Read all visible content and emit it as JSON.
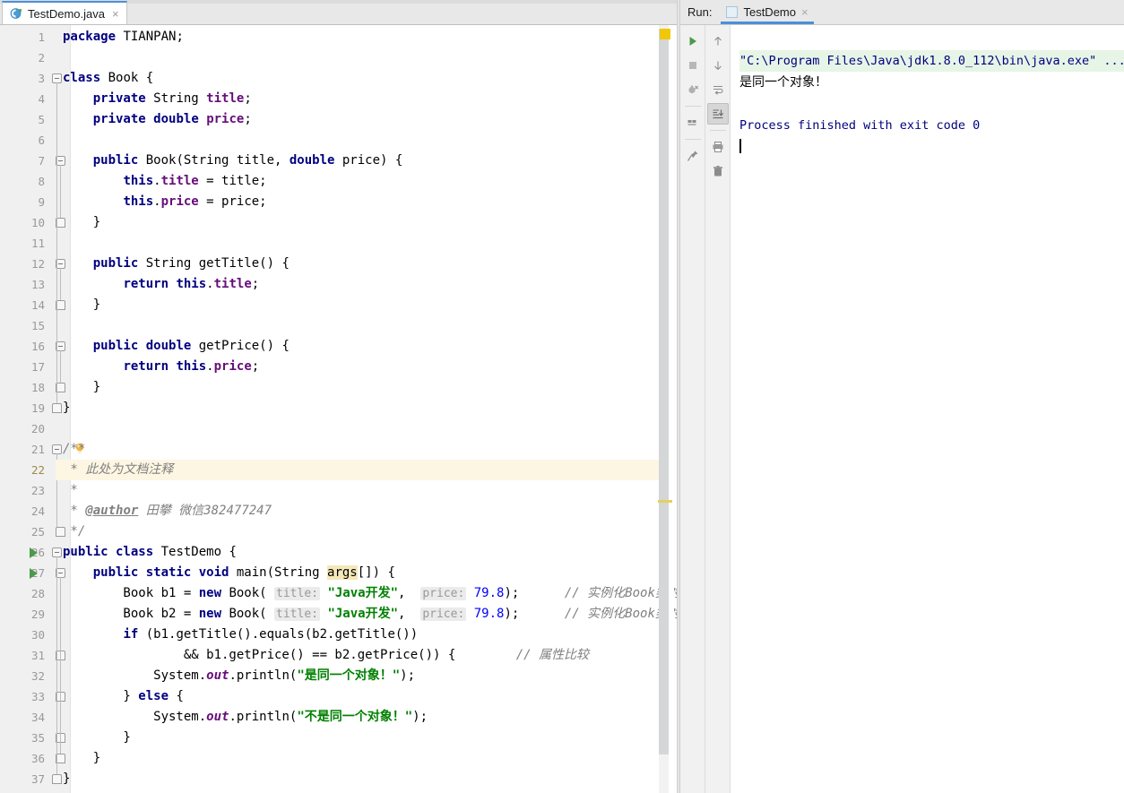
{
  "editor": {
    "tab": {
      "label": "TestDemo.java",
      "icon": "java-class-icon",
      "close": "×"
    },
    "lines": [
      {
        "n": 1,
        "tokens": [
          {
            "t": "kw",
            "s": "package"
          },
          {
            "t": "p",
            "s": " TIANPAN;"
          }
        ],
        "indent": 0
      },
      {
        "n": 2,
        "tokens": [],
        "indent": 0
      },
      {
        "n": 3,
        "tokens": [
          {
            "t": "kw",
            "s": "class"
          },
          {
            "t": "p",
            "s": " Book {"
          }
        ],
        "indent": 0
      },
      {
        "n": 4,
        "tokens": [
          {
            "t": "p",
            "s": "    "
          },
          {
            "t": "kw",
            "s": "private"
          },
          {
            "t": "p",
            "s": " String "
          },
          {
            "t": "fld",
            "s": "title"
          },
          {
            "t": "p",
            "s": ";"
          }
        ],
        "indent": 1
      },
      {
        "n": 5,
        "tokens": [
          {
            "t": "p",
            "s": "    "
          },
          {
            "t": "kw",
            "s": "private"
          },
          {
            "t": "p",
            "s": " "
          },
          {
            "t": "kw",
            "s": "double"
          },
          {
            "t": "p",
            "s": " "
          },
          {
            "t": "fld",
            "s": "price"
          },
          {
            "t": "p",
            "s": ";"
          }
        ],
        "indent": 1
      },
      {
        "n": 6,
        "tokens": [],
        "indent": 0
      },
      {
        "n": 7,
        "tokens": [
          {
            "t": "p",
            "s": "    "
          },
          {
            "t": "kw",
            "s": "public"
          },
          {
            "t": "p",
            "s": " Book(String title, "
          },
          {
            "t": "kw",
            "s": "double"
          },
          {
            "t": "p",
            "s": " price) {"
          }
        ],
        "indent": 1
      },
      {
        "n": 8,
        "tokens": [
          {
            "t": "p",
            "s": "        "
          },
          {
            "t": "kw",
            "s": "this"
          },
          {
            "t": "p",
            "s": "."
          },
          {
            "t": "fld",
            "s": "title"
          },
          {
            "t": "p",
            "s": " = title;"
          }
        ],
        "indent": 2
      },
      {
        "n": 9,
        "tokens": [
          {
            "t": "p",
            "s": "        "
          },
          {
            "t": "kw",
            "s": "this"
          },
          {
            "t": "p",
            "s": "."
          },
          {
            "t": "fld",
            "s": "price"
          },
          {
            "t": "p",
            "s": " = price;"
          }
        ],
        "indent": 2
      },
      {
        "n": 10,
        "tokens": [
          {
            "t": "p",
            "s": "    }"
          }
        ],
        "indent": 1
      },
      {
        "n": 11,
        "tokens": [],
        "indent": 0
      },
      {
        "n": 12,
        "tokens": [
          {
            "t": "p",
            "s": "    "
          },
          {
            "t": "kw",
            "s": "public"
          },
          {
            "t": "p",
            "s": " String getTitle() {"
          }
        ],
        "indent": 1
      },
      {
        "n": 13,
        "tokens": [
          {
            "t": "p",
            "s": "        "
          },
          {
            "t": "kw",
            "s": "return"
          },
          {
            "t": "p",
            "s": " "
          },
          {
            "t": "kw",
            "s": "this"
          },
          {
            "t": "p",
            "s": "."
          },
          {
            "t": "fld",
            "s": "title"
          },
          {
            "t": "p",
            "s": ";"
          }
        ],
        "indent": 2
      },
      {
        "n": 14,
        "tokens": [
          {
            "t": "p",
            "s": "    }"
          }
        ],
        "indent": 1
      },
      {
        "n": 15,
        "tokens": [],
        "indent": 0
      },
      {
        "n": 16,
        "tokens": [
          {
            "t": "p",
            "s": "    "
          },
          {
            "t": "kw",
            "s": "public"
          },
          {
            "t": "p",
            "s": " "
          },
          {
            "t": "kw",
            "s": "double"
          },
          {
            "t": "p",
            "s": " getPrice() {"
          }
        ],
        "indent": 1
      },
      {
        "n": 17,
        "tokens": [
          {
            "t": "p",
            "s": "        "
          },
          {
            "t": "kw",
            "s": "return"
          },
          {
            "t": "p",
            "s": " "
          },
          {
            "t": "kw",
            "s": "this"
          },
          {
            "t": "p",
            "s": "."
          },
          {
            "t": "fld",
            "s": "price"
          },
          {
            "t": "p",
            "s": ";"
          }
        ],
        "indent": 2
      },
      {
        "n": 18,
        "tokens": [
          {
            "t": "p",
            "s": "    }"
          }
        ],
        "indent": 1
      },
      {
        "n": 19,
        "tokens": [
          {
            "t": "p",
            "s": "}"
          }
        ],
        "indent": 0
      },
      {
        "n": 20,
        "tokens": [],
        "indent": 0
      },
      {
        "n": 21,
        "tokens": [
          {
            "t": "jdoc",
            "s": "/**"
          }
        ],
        "indent": 0
      },
      {
        "n": 22,
        "tokens": [
          {
            "t": "jdoc",
            "s": " * 此处为文档注释"
          }
        ],
        "indent": 0,
        "highlight": true
      },
      {
        "n": 23,
        "tokens": [
          {
            "t": "jdoc",
            "s": " *"
          }
        ],
        "indent": 0
      },
      {
        "n": 24,
        "tokens": [
          {
            "t": "jdoc",
            "s": " * "
          },
          {
            "t": "jdoctag",
            "s": "@author"
          },
          {
            "t": "jdoc",
            "s": " 田攀 微信382477247"
          }
        ],
        "indent": 0
      },
      {
        "n": 25,
        "tokens": [
          {
            "t": "jdoc",
            "s": " */"
          }
        ],
        "indent": 0
      },
      {
        "n": 26,
        "tokens": [
          {
            "t": "kw",
            "s": "public class"
          },
          {
            "t": "p",
            "s": " TestDemo {"
          }
        ],
        "indent": 0
      },
      {
        "n": 27,
        "tokens": [
          {
            "t": "p",
            "s": "    "
          },
          {
            "t": "kw",
            "s": "public static void"
          },
          {
            "t": "p",
            "s": " main(String "
          },
          {
            "t": "hl",
            "s": "args"
          },
          {
            "t": "p",
            "s": "[]) {"
          }
        ],
        "indent": 1
      },
      {
        "n": 28,
        "tokens": [
          {
            "t": "p",
            "s": "        Book b1 = "
          },
          {
            "t": "kw",
            "s": "new"
          },
          {
            "t": "p",
            "s": " Book( "
          },
          {
            "t": "hint",
            "s": "title:"
          },
          {
            "t": "p",
            "s": " "
          },
          {
            "t": "str",
            "s": "\"Java开发\""
          },
          {
            "t": "p",
            "s": ",  "
          },
          {
            "t": "hint",
            "s": "price:"
          },
          {
            "t": "p",
            "s": " "
          },
          {
            "t": "num",
            "s": "79.8"
          },
          {
            "t": "p",
            "s": ");      "
          },
          {
            "t": "cmt",
            "s": "// 实例化Book类对象"
          }
        ],
        "indent": 2
      },
      {
        "n": 29,
        "tokens": [
          {
            "t": "p",
            "s": "        Book b2 = "
          },
          {
            "t": "kw",
            "s": "new"
          },
          {
            "t": "p",
            "s": " Book( "
          },
          {
            "t": "hint",
            "s": "title:"
          },
          {
            "t": "p",
            "s": " "
          },
          {
            "t": "str",
            "s": "\"Java开发\""
          },
          {
            "t": "p",
            "s": ",  "
          },
          {
            "t": "hint",
            "s": "price:"
          },
          {
            "t": "p",
            "s": " "
          },
          {
            "t": "num",
            "s": "79.8"
          },
          {
            "t": "p",
            "s": ");      "
          },
          {
            "t": "cmt",
            "s": "// 实例化Book类对象"
          }
        ],
        "indent": 2
      },
      {
        "n": 30,
        "tokens": [
          {
            "t": "p",
            "s": "        "
          },
          {
            "t": "kw",
            "s": "if"
          },
          {
            "t": "p",
            "s": " (b1.getTitle().equals(b2.getTitle())"
          }
        ],
        "indent": 2
      },
      {
        "n": 31,
        "tokens": [
          {
            "t": "p",
            "s": "                && b1.getPrice() == b2.getPrice()) {        "
          },
          {
            "t": "cmt",
            "s": "// 属性比较"
          }
        ],
        "indent": 3
      },
      {
        "n": 32,
        "tokens": [
          {
            "t": "p",
            "s": "            System."
          },
          {
            "t": "stc",
            "s": "out"
          },
          {
            "t": "p",
            "s": ".println("
          },
          {
            "t": "str",
            "s": "\"是同一个对象！\""
          },
          {
            "t": "p",
            "s": ");"
          }
        ],
        "indent": 3
      },
      {
        "n": 33,
        "tokens": [
          {
            "t": "p",
            "s": "        } "
          },
          {
            "t": "kw",
            "s": "else"
          },
          {
            "t": "p",
            "s": " {"
          }
        ],
        "indent": 2
      },
      {
        "n": 34,
        "tokens": [
          {
            "t": "p",
            "s": "            System."
          },
          {
            "t": "stc",
            "s": "out"
          },
          {
            "t": "p",
            "s": ".println("
          },
          {
            "t": "str",
            "s": "\"不是同一个对象！\""
          },
          {
            "t": "p",
            "s": ");"
          }
        ],
        "indent": 3
      },
      {
        "n": 35,
        "tokens": [
          {
            "t": "p",
            "s": "        }"
          }
        ],
        "indent": 2
      },
      {
        "n": 36,
        "tokens": [
          {
            "t": "p",
            "s": "    }"
          }
        ],
        "indent": 1
      },
      {
        "n": 37,
        "tokens": [
          {
            "t": "p",
            "s": "}"
          }
        ],
        "indent": 0
      }
    ],
    "gutter": {
      "run_arrow_lines": [
        26,
        27
      ],
      "bulb_line": 21,
      "fold_open_lines": [
        3,
        7,
        12,
        16,
        21,
        26,
        27
      ],
      "fold_end_lines": [
        10,
        14,
        18,
        19,
        25,
        31,
        33,
        35,
        36,
        37
      ]
    },
    "scrollbar": {
      "warning_marker_color": "#f0c808",
      "change_marker_color": "#e8cf5a"
    }
  },
  "run_panel": {
    "label": "Run:",
    "tab": {
      "label": "TestDemo",
      "close": "×",
      "icon": "run-config-icon"
    },
    "toolbar_left": [
      {
        "name": "rerun-icon",
        "title": "Rerun"
      },
      {
        "name": "stop-icon",
        "title": "Stop"
      },
      {
        "name": "rerun-failed-icon",
        "title": "Rerun Failed"
      },
      {
        "name": "layout-icon",
        "title": "Layout Settings"
      },
      {
        "name": "pin-icon",
        "title": "Pin Tab"
      }
    ],
    "toolbar_right": [
      {
        "name": "arrow-up-icon",
        "title": "Up the Stack Trace"
      },
      {
        "name": "arrow-down-icon",
        "title": "Down the Stack Trace"
      },
      {
        "name": "soft-wrap-icon",
        "title": "Use Soft Wraps"
      },
      {
        "name": "scroll-to-end-icon",
        "title": "Scroll to End",
        "active": true
      },
      {
        "name": "print-icon",
        "title": "Print"
      },
      {
        "name": "trash-icon",
        "title": "Clear All"
      }
    ],
    "console": {
      "command": "\"C:\\Program Files\\Java\\jdk1.8.0_112\\bin\\java.exe\" ...",
      "output": "是同一个对象！",
      "blank": "",
      "finished": "Process finished with exit code 0"
    }
  },
  "colors": {
    "accent": "#4a90d9",
    "keyword": "#000080",
    "string": "#008000",
    "number": "#0000ff",
    "field": "#660e7a",
    "comment": "#808080",
    "run_green": "#4a9a4a",
    "console_cmd_bg": "#e6f5e6",
    "highlight_line": "#fdf6e3"
  }
}
